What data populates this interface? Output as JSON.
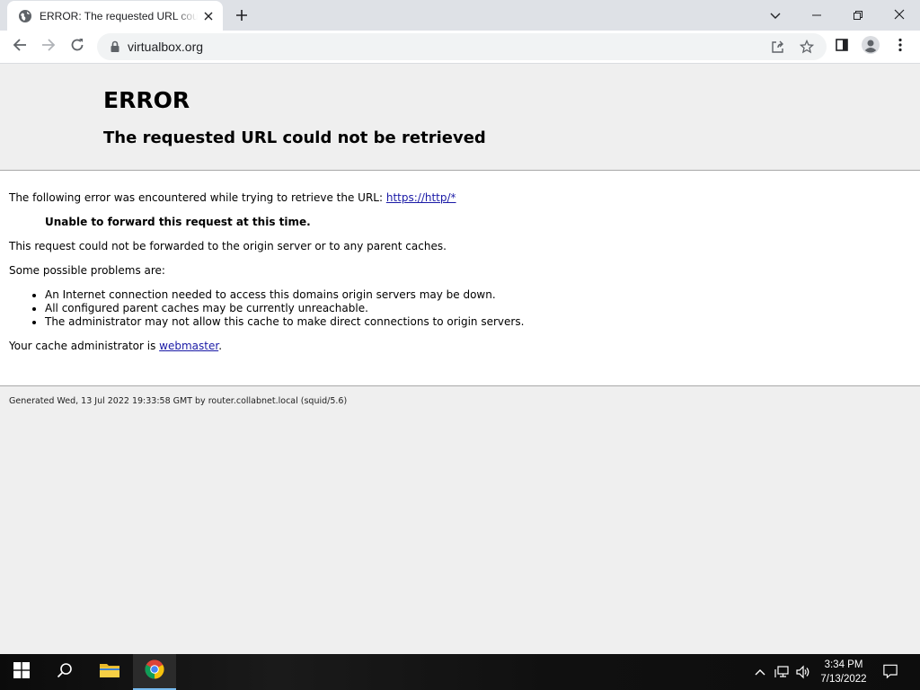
{
  "browser": {
    "tab_title": "ERROR: The requested URL could not be retrieved",
    "url": "virtualbox.org"
  },
  "page": {
    "heading": "ERROR",
    "subheading": "The requested URL could not be retrieved",
    "intro_text": "The following error was encountered while trying to retrieve the URL: ",
    "intro_link": "https://http/*",
    "error_message": "Unable to forward this request at this time.",
    "explanation": "This request could not be forwarded to the origin server or to any parent caches.",
    "problems_intro": "Some possible problems are:",
    "problems": [
      "An Internet connection needed to access this domains origin servers may be down.",
      "All configured parent caches may be currently unreachable.",
      "The administrator may not allow this cache to make direct connections to origin servers."
    ],
    "admin_text": "Your cache administrator is ",
    "admin_link": "webmaster",
    "admin_suffix": ".",
    "footer": "Generated Wed, 13 Jul 2022 19:33:58 GMT by router.collabnet.local (squid/5.6)"
  },
  "taskbar": {
    "time": "3:34 PM",
    "date": "7/13/2022"
  },
  "icons": {
    "tab_favicon": "globe-icon",
    "tab_close": "close-icon",
    "new_tab": "plus-icon",
    "back": "back-arrow-icon",
    "forward": "forward-arrow-icon",
    "reload": "reload-icon",
    "lock": "lock-icon",
    "share": "share-icon",
    "bookmark": "star-icon",
    "side_panel": "side-panel-icon",
    "profile": "profile-icon",
    "menu": "kebab-menu-icon"
  },
  "colors": {
    "tabstrip": "#dee1e6",
    "page_header_bg": "#efefef",
    "link": "#1a1aa6",
    "taskbar": "#101010",
    "taskbar_active": "#76b9ed"
  }
}
